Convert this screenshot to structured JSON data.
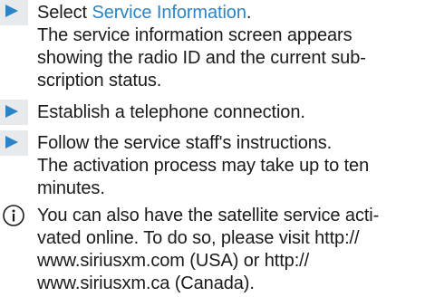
{
  "steps": [
    {
      "action_prefix": "Select ",
      "action_link": "Service Information",
      "action_suffix": ".",
      "result_lines": [
        "The service information screen appears",
        "showing the radio ID and the current sub-",
        "scription status."
      ]
    },
    {
      "action": "Establish a telephone connection."
    },
    {
      "action": "Follow the service staff's instructions.",
      "result_lines": [
        "The activation process may take up to ten",
        "minutes."
      ]
    }
  ],
  "note": {
    "icon": "info-icon",
    "lines": [
      "You can also have the satellite service acti-",
      "vated online. To do so, please visit http://",
      "www.siriusxm.com (USA) or http://",
      "www.siriusxm.ca (Canada)."
    ]
  },
  "colors": {
    "accent": "#2b84c6",
    "marker_bg": "#e6eaed",
    "text": "#1a1a1a"
  }
}
